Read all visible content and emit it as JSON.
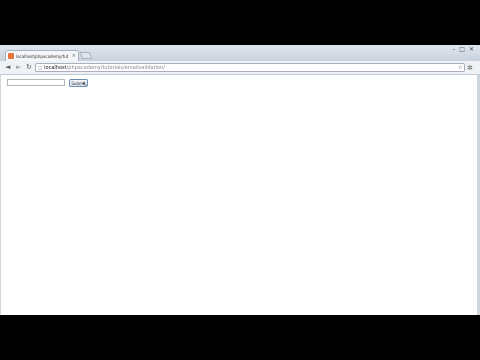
{
  "browser": {
    "tab": {
      "title": "localhost/phpacademy/tut",
      "close_glyph": "×"
    },
    "window_controls": {
      "minimize": "–",
      "maximize": "□",
      "close": "✕"
    },
    "nav": {
      "back": "◄",
      "forward": "►",
      "reload": "↻"
    },
    "address": {
      "host": "localhost",
      "path": "/phpacademy/tutorials/emailvalidation/"
    },
    "star_glyph": "☆",
    "wrench_glyph": "🔧"
  },
  "form": {
    "text_value": "",
    "submit_label": "Submit"
  }
}
